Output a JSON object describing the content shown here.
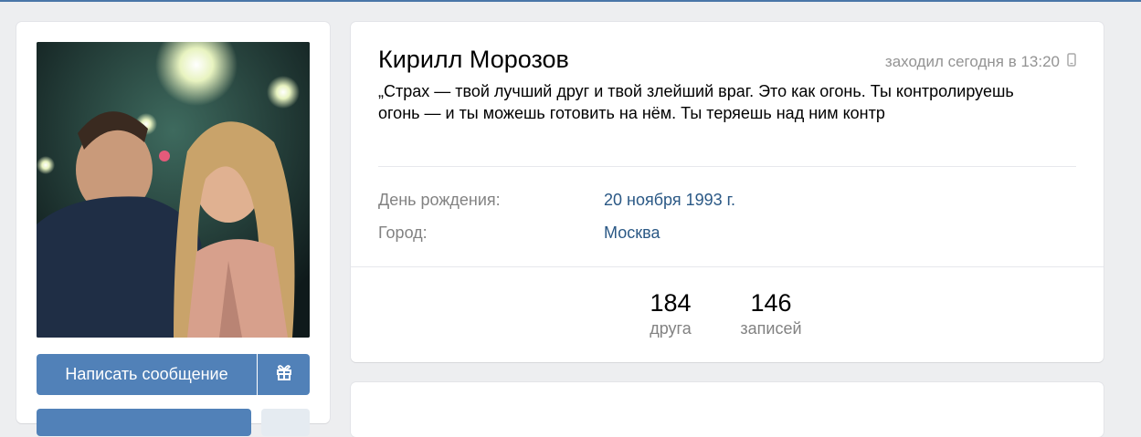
{
  "profile": {
    "name": "Кирилл Морозов",
    "last_seen": "заходил сегодня в 13:20",
    "status": "„Страх — твой лучший друг и твой злейший враг. Это как огонь. Ты контролируешь огонь — и ты можешь готовить на нём. Ты теряешь над ним контр",
    "info": [
      {
        "label": "День рождения:",
        "value": "20 ноября 1993 г."
      },
      {
        "label": "Город:",
        "value": "Москва"
      }
    ],
    "counters": [
      {
        "number": "184",
        "label": "друга"
      },
      {
        "number": "146",
        "label": "записей"
      }
    ]
  },
  "actions": {
    "send_message_label": "Написать сообщение",
    "gift_icon": "gift-icon"
  },
  "icons": {
    "online_device": "mobile-phone-icon"
  },
  "colors": {
    "page_bg": "#edeef0",
    "button_blue": "#5181b8",
    "link_blue": "#2a5885",
    "muted_text": "#828282"
  }
}
